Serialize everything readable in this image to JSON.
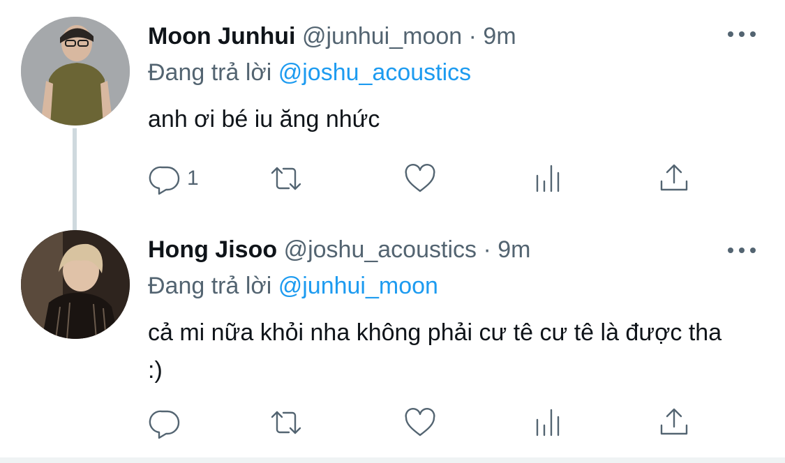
{
  "tweets": [
    {
      "name": "Moon Junhui",
      "handle": "@junhui_moon",
      "separator": "·",
      "time": "9m",
      "reply_prefix": "Đang trả lời",
      "reply_mention": "@joshu_acoustics",
      "text": "anh ơi bé iu ăng nhức",
      "reply_count": "1"
    },
    {
      "name": "Hong Jisoo",
      "handle": "@joshu_acoustics",
      "separator": "·",
      "time": "9m",
      "reply_prefix": "Đang trả lời",
      "reply_mention": "@junhui_moon",
      "text": "cả mi nữa khỏi nha không phải cư tê cư tê là được tha :)",
      "reply_count": ""
    }
  ],
  "colors": {
    "text": "#0f1419",
    "secondary": "#536471",
    "link": "#1d9bf0",
    "thread_line": "#cfd9de"
  },
  "icons": [
    "reply-icon",
    "retweet-icon",
    "like-icon",
    "views-icon",
    "share-icon",
    "more-icon"
  ]
}
